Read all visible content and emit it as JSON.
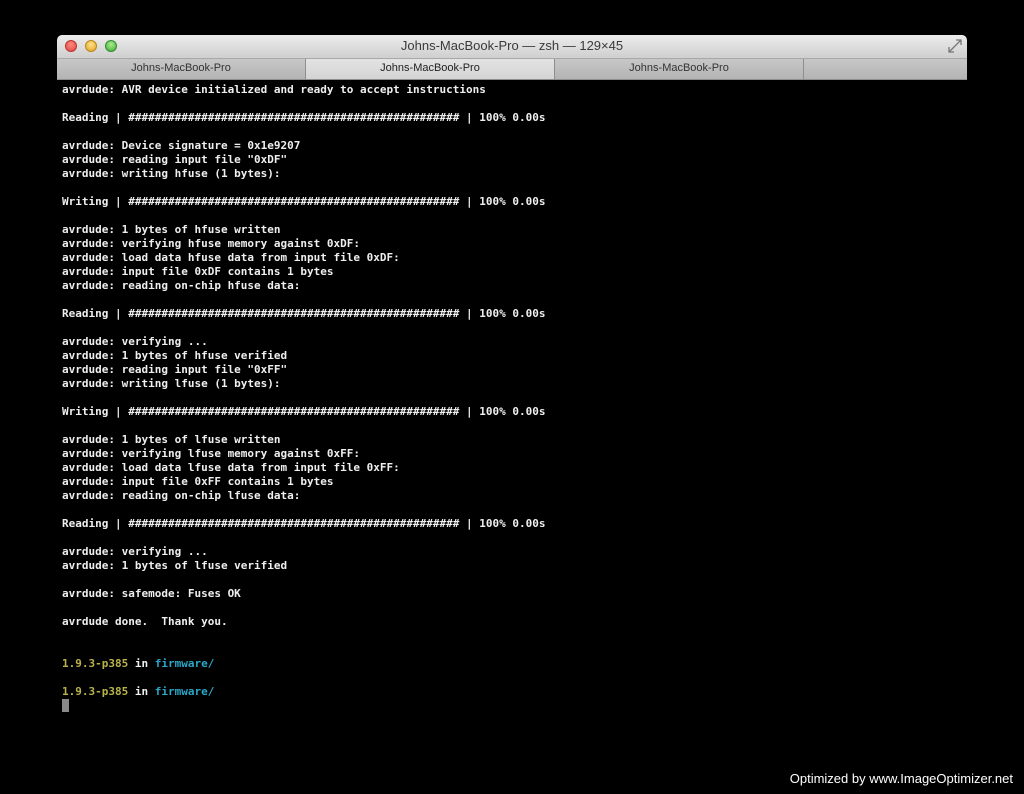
{
  "window": {
    "title": "Johns-MacBook-Pro — zsh — 129×45"
  },
  "tabs": [
    {
      "label": "Johns-MacBook-Pro"
    },
    {
      "label": "Johns-MacBook-Pro"
    },
    {
      "label": "Johns-MacBook-Pro"
    }
  ],
  "terminal": {
    "lines": [
      "avrdude: AVR device initialized and ready to accept instructions",
      "",
      "Reading | ################################################## | 100% 0.00s",
      "",
      "avrdude: Device signature = 0x1e9207",
      "avrdude: reading input file \"0xDF\"",
      "avrdude: writing hfuse (1 bytes):",
      "",
      "Writing | ################################################## | 100% 0.00s",
      "",
      "avrdude: 1 bytes of hfuse written",
      "avrdude: verifying hfuse memory against 0xDF:",
      "avrdude: load data hfuse data from input file 0xDF:",
      "avrdude: input file 0xDF contains 1 bytes",
      "avrdude: reading on-chip hfuse data:",
      "",
      "Reading | ################################################## | 100% 0.00s",
      "",
      "avrdude: verifying ...",
      "avrdude: 1 bytes of hfuse verified",
      "avrdude: reading input file \"0xFF\"",
      "avrdude: writing lfuse (1 bytes):",
      "",
      "Writing | ################################################## | 100% 0.00s",
      "",
      "avrdude: 1 bytes of lfuse written",
      "avrdude: verifying lfuse memory against 0xFF:",
      "avrdude: load data lfuse data from input file 0xFF:",
      "avrdude: input file 0xFF contains 1 bytes",
      "avrdude: reading on-chip lfuse data:",
      "",
      "Reading | ################################################## | 100% 0.00s",
      "",
      "avrdude: verifying ...",
      "avrdude: 1 bytes of lfuse verified",
      "",
      "avrdude: safemode: Fuses OK",
      "",
      "avrdude done.  Thank you.",
      "",
      ""
    ],
    "prompts": [
      {
        "version": "1.9.3-p385",
        "in": " in ",
        "dir": "firmware/"
      },
      {
        "version": "1.9.3-p385",
        "in": " in ",
        "dir": "firmware/"
      }
    ]
  },
  "watermark": "Optimized by www.ImageOptimizer.net",
  "colors": {
    "background": "#000000",
    "text": "#efefef",
    "prompt_version": "#b8b24d",
    "prompt_dir": "#2aa7c6",
    "cursor": "#8a8a8a"
  }
}
